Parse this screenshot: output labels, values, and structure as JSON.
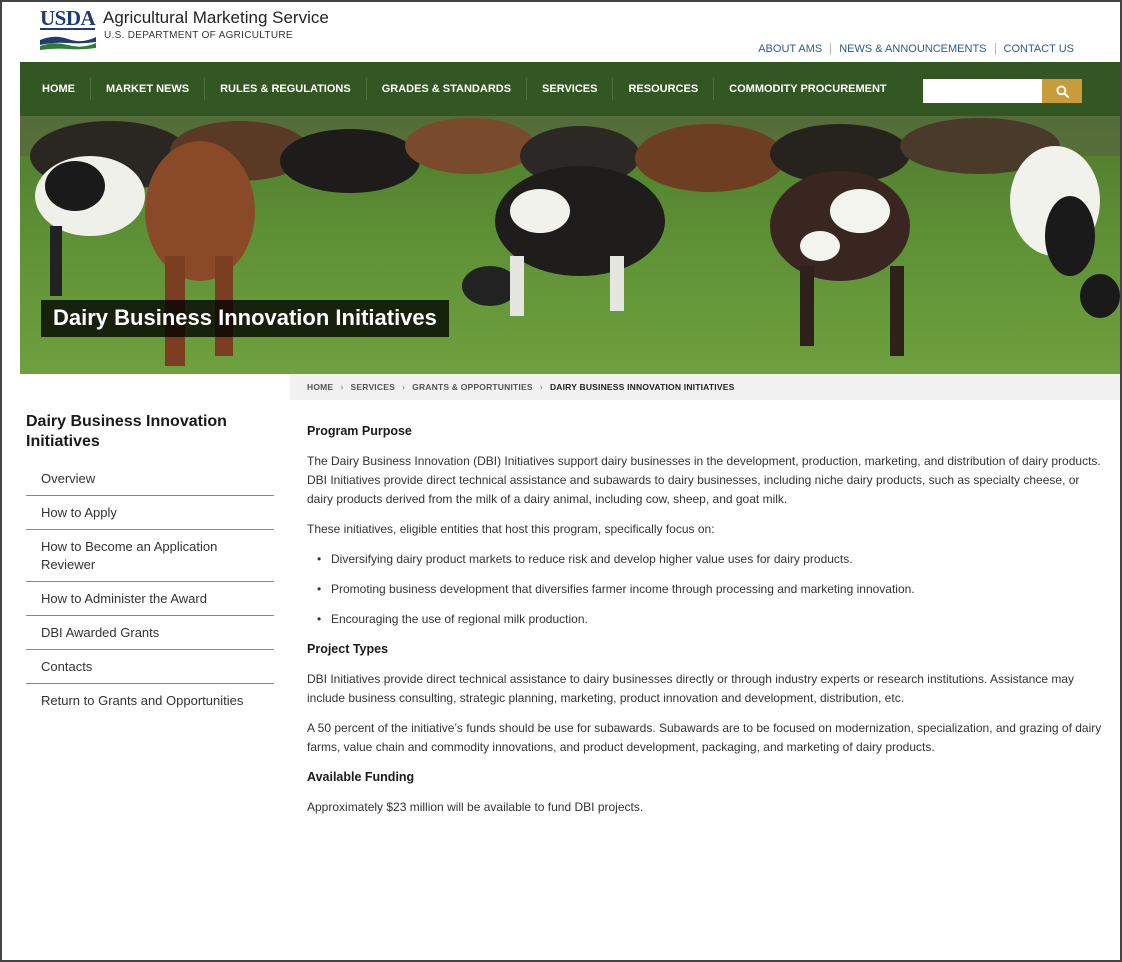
{
  "header": {
    "logo_text": "USDA",
    "agency": "Agricultural Marketing Service",
    "department": "U.S. DEPARTMENT OF AGRICULTURE",
    "utility_links": [
      "ABOUT AMS",
      "NEWS & ANNOUNCEMENTS",
      "CONTACT US"
    ]
  },
  "nav": {
    "items": [
      "HOME",
      "MARKET NEWS",
      "RULES & REGULATIONS",
      "GRADES & STANDARDS",
      "SERVICES",
      "RESOURCES",
      "COMMODITY PROCUREMENT"
    ],
    "search_value": "",
    "search_icon": "search-icon"
  },
  "hero": {
    "title": "Dairy Business Innovation Initiatives"
  },
  "breadcrumb": [
    "HOME",
    "SERVICES",
    "GRANTS & OPPORTUNITIES",
    "DAIRY BUSINESS INNOVATION INITIATIVES"
  ],
  "sidebar": {
    "title": "Dairy Business Innovation Initiatives",
    "items": [
      "Overview",
      "How to Apply",
      "How to Become an Application Reviewer",
      "How to Administer the Award",
      "DBI Awarded Grants",
      "Contacts",
      "Return to Grants and Opportunities"
    ]
  },
  "content": {
    "purpose_heading": "Program Purpose",
    "purpose_p1": "The Dairy Business Innovation (DBI) Initiatives support dairy businesses in the development, production, marketing, and distribution of dairy products. DBI Initiatives provide direct technical assistance and subawards to dairy businesses, including niche dairy products, such as specialty cheese, or dairy products derived from the milk of a dairy animal, including cow, sheep, and goat milk.",
    "purpose_p2": "These initiatives, eligible entities that host this program, specifically focus on:",
    "focus_items": [
      "Diversifying dairy product markets to reduce risk and develop higher value uses for dairy products.",
      "Promoting business development that diversifies farmer income through processing and marketing innovation.",
      "Encouraging the use of regional milk production."
    ],
    "types_heading": "Project Types",
    "types_p1": "DBI Initiatives provide direct technical assistance to dairy businesses directly or through industry experts or research institutions.  Assistance may include business consulting, strategic planning, marketing, product innovation and development, distribution, etc.",
    "types_p2": "A 50 percent of the initiative’s funds should be use for subawards. Subawards are to be focused on modernization, specialization, and grazing of dairy farms, value chain and commodity innovations, and product development, packaging, and marketing of dairy products.",
    "funding_heading": "Available Funding",
    "funding_p1": "Approximately $23 million will be available to fund DBI projects."
  },
  "colors": {
    "nav_green": "#325722",
    "search_gold": "#c89b3b",
    "usda_blue": "#1f3b73",
    "link_blue": "#2a5d8f"
  }
}
